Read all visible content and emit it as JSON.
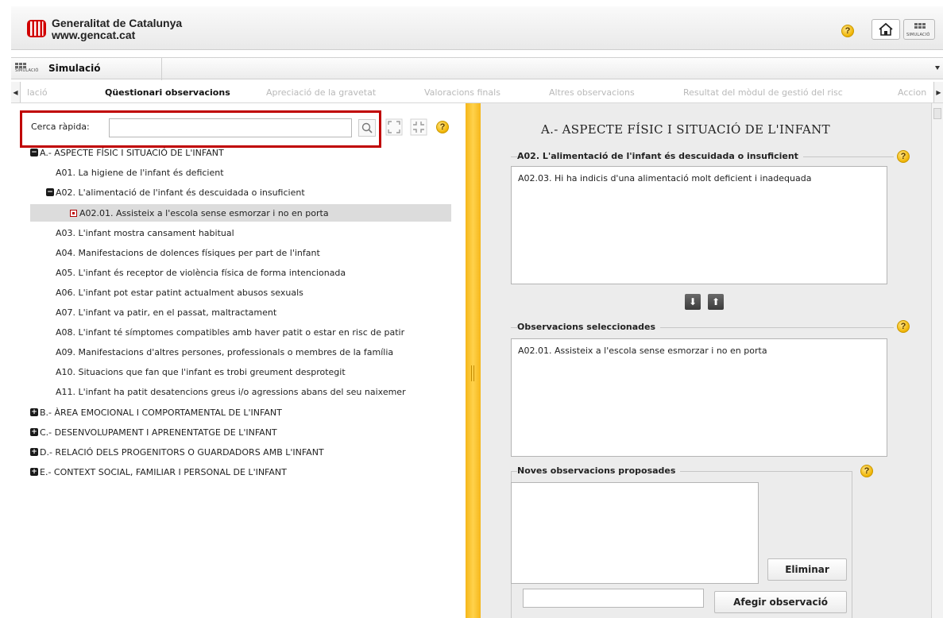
{
  "header": {
    "org_line1": "Generalitat de Catalunya",
    "org_line2": "www.gencat.cat",
    "help_glyph": "?",
    "sim_logo_text": "SIMULACIÓ"
  },
  "titlebar": {
    "icon_text": "SIMULACIÓ",
    "title": "Simulació"
  },
  "tabs": [
    {
      "label": "lació",
      "active": false
    },
    {
      "label": "Qüestionari observacions",
      "active": true
    },
    {
      "label": "Apreciació de la gravetat",
      "active": false
    },
    {
      "label": "Valoracions finals",
      "active": false
    },
    {
      "label": "Altres observacions",
      "active": false
    },
    {
      "label": "Resultat del mòdul de gestió del risc",
      "active": false
    },
    {
      "label": "Accion",
      "active": false
    }
  ],
  "search": {
    "label": "Cerca ràpida:",
    "value": ""
  },
  "tree": [
    {
      "text": "A.- ASPECTE FÍSIC I SITUACIÓ DE L'INFANT",
      "toggle": "−"
    },
    {
      "text": "A01. La higiene de l'infant és deficient"
    },
    {
      "text": "A02. L'alimentació de l'infant és descuidada o insuficient",
      "toggle": "−"
    },
    {
      "text": "A02.01. Assisteix a l'escola sense esmorzar i no en porta",
      "selected": true
    },
    {
      "text": "A03. L'infant mostra cansament habitual"
    },
    {
      "text": "A04. Manifestacions de dolences físiques per part de l'infant"
    },
    {
      "text": "A05. L'infant és receptor de violència física de forma intencionada"
    },
    {
      "text": "A06. L'infant pot estar patint actualment abusos sexuals"
    },
    {
      "text": "A07. L'infant va patir, en el passat, maltractament"
    },
    {
      "text": "A08. L'infant té símptomes compatibles amb haver patit o estar en risc de patir"
    },
    {
      "text": "A09. Manifestacions d'altres persones, professionals o membres de la família"
    },
    {
      "text": "A10. Situacions que fan que l'infant es trobi greument desprotegit"
    },
    {
      "text": "A11. L'infant ha patit desatencions greus i/o agressions abans del seu naixemer"
    },
    {
      "text": "B.- ÀREA EMOCIONAL I COMPORTAMENTAL DE L'INFANT",
      "toggle": "+"
    },
    {
      "text": "C.- DESENVOLUPAMENT I APRENENTATGE DE L'INFANT",
      "toggle": "+"
    },
    {
      "text": "D.- RELACIÓ DELS PROGENITORS O GUARDADORS AMB L'INFANT",
      "toggle": "+"
    },
    {
      "text": "E.- CONTEXT SOCIAL, FAMILIAR I PERSONAL DE L'INFANT",
      "toggle": "+"
    }
  ],
  "right": {
    "section_title": "A.- ASPECTE FÍSIC I SITUACIÓ DE L'INFANT",
    "available": {
      "legend": "A02. L'alimentació de l'infant és descuidada o insuficient",
      "items": [
        "A02.03. Hi ha indicis d'una alimentació molt deficient i inadequada"
      ]
    },
    "move_down_glyph": "⬇",
    "move_up_glyph": "⬆",
    "selected": {
      "legend": "Observacions seleccionades",
      "items": [
        "A02.01. Assisteix a l'escola sense esmorzar i no en porta"
      ]
    },
    "proposed": {
      "legend": "Noves observacions proposades",
      "remove_label": "Eliminar",
      "add_label": "Afegir observació",
      "new_value": ""
    }
  }
}
